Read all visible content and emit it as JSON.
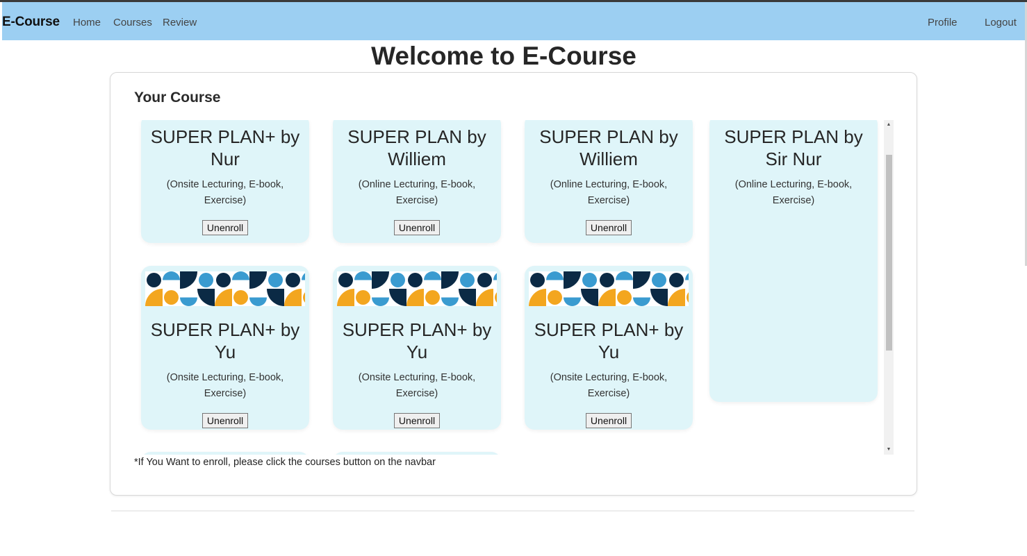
{
  "navbar": {
    "brand": "E-Course",
    "links": {
      "home": "Home",
      "courses": "Courses",
      "review": "Review"
    },
    "right": {
      "profile": "Profile",
      "logout": "Logout"
    },
    "background": "#9ccff2"
  },
  "page_title": "Welcome to E-Course",
  "panel": {
    "heading": "Your Course",
    "footnote": "*If You Want to enroll, please click the courses button on the navbar"
  },
  "courses": [
    {
      "title": "SUPER PLAN+ by Nur",
      "features": "(Onsite Lecturing, E-book, Exercise)",
      "button": "Unenroll"
    },
    {
      "title": "SUPER PLAN by Williem",
      "features": "(Online Lecturing, E-book, Exercise)",
      "button": "Unenroll"
    },
    {
      "title": "SUPER PLAN by Williem",
      "features": "(Online Lecturing, E-book, Exercise)",
      "button": "Unenroll"
    },
    {
      "title": "SUPER PLAN by Sir Nur",
      "features": "(Online Lecturing, E-book, Exercise)"
    },
    {
      "title": "SUPER PLAN+ by Yu",
      "features": "(Onsite Lecturing, E-book, Exercise)",
      "button": "Unenroll"
    },
    {
      "title": "SUPER PLAN+ by Yu",
      "features": "(Onsite Lecturing, E-book, Exercise)",
      "button": "Unenroll"
    },
    {
      "title": "SUPER PLAN+ by Yu",
      "features": "(Onsite Lecturing, E-book, Exercise)",
      "button": "Unenroll"
    }
  ],
  "colors": {
    "card_bg": "#dff5f9",
    "pattern_navy": "#0b2a45",
    "pattern_yellow": "#f3a61f",
    "pattern_blue": "#3a9bd0",
    "pattern_cream": "#ffffff"
  },
  "icons": {
    "course_banner": "geometric-pattern-banner",
    "scroll_up": "scroll-up-arrow-icon",
    "scroll_down": "scroll-down-arrow-icon"
  }
}
